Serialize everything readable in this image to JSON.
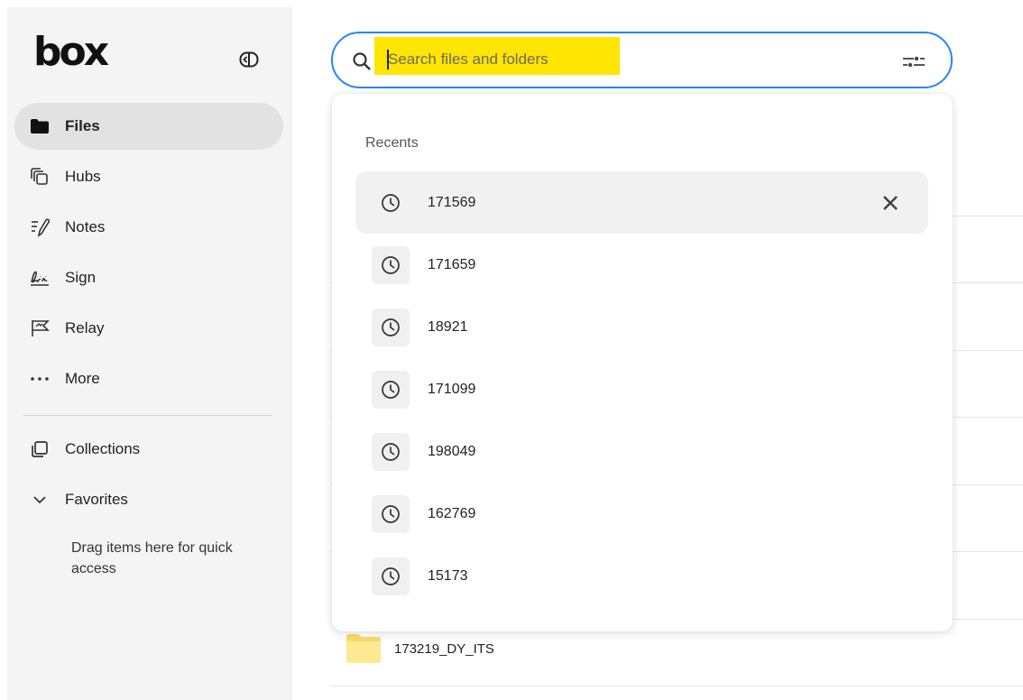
{
  "app": {
    "logo_text": "box"
  },
  "sidebar": {
    "collapse_label": "collapse-sidebar",
    "items": [
      {
        "label": "Files",
        "icon": "folder-icon",
        "active": true
      },
      {
        "label": "Hubs",
        "icon": "hubs-icon",
        "active": false
      },
      {
        "label": "Notes",
        "icon": "notes-icon",
        "active": false
      },
      {
        "label": "Sign",
        "icon": "sign-icon",
        "active": false
      },
      {
        "label": "Relay",
        "icon": "relay-icon",
        "active": false
      },
      {
        "label": "More",
        "icon": "more-icon",
        "active": false
      }
    ],
    "collections_label": "Collections",
    "favorites_label": "Favorites",
    "favorites_hint": "Drag items here for quick access"
  },
  "search": {
    "placeholder": "Search files and folders",
    "highlight_color": "#ffe500",
    "border_color": "#2486fc"
  },
  "recents": {
    "title": "Recents",
    "items": [
      {
        "label": "171569",
        "active": true
      },
      {
        "label": "171659",
        "active": false
      },
      {
        "label": "18921",
        "active": false
      },
      {
        "label": "171099",
        "active": false
      },
      {
        "label": "198049",
        "active": false
      },
      {
        "label": "162769",
        "active": false
      },
      {
        "label": "15173",
        "active": false
      }
    ]
  },
  "files": {
    "visible_folder": "173219_DY_ITS",
    "folder_color": "#fcd96a"
  }
}
